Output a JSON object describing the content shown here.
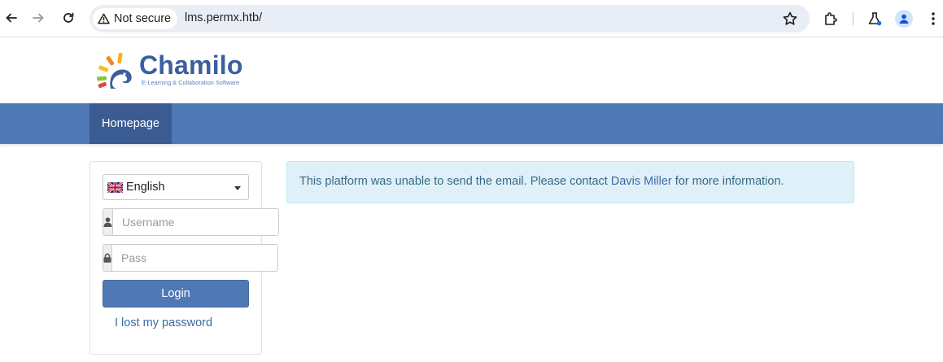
{
  "browser": {
    "security_label": "Not secure",
    "url": "lms.permx.htb/"
  },
  "logo": {
    "title": "Chamilo",
    "subtitle": "E-Learning & Collaboration Software"
  },
  "navbar": {
    "home_label": "Homepage"
  },
  "login": {
    "language": "English",
    "username_placeholder": "Username",
    "password_placeholder": "Pass",
    "login_label": "Login",
    "lost_password_label": "I lost my password"
  },
  "alert": {
    "text_before": "This platform was unable to send the email. Please contact ",
    "contact_name": "Davis Miller",
    "text_after": " for more information."
  },
  "colors": {
    "brand": "#4f79b5",
    "brand_dark": "#3b5c93",
    "alert_bg": "#dff0f8"
  }
}
